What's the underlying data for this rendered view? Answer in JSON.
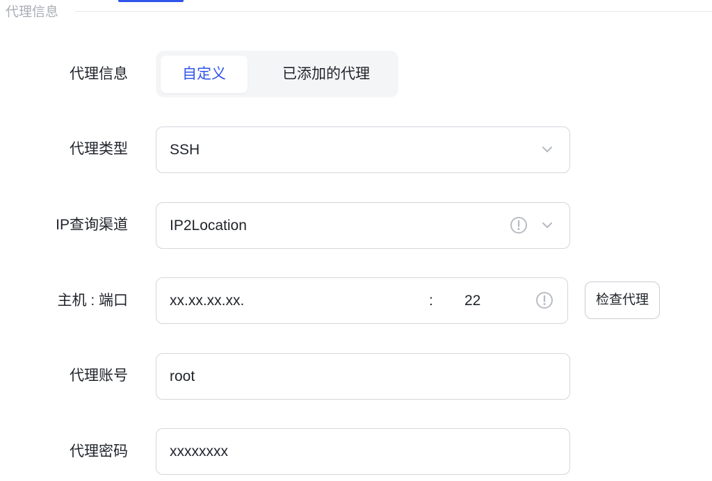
{
  "section": {
    "title": "代理信息"
  },
  "proxy_info": {
    "label": "代理信息",
    "tabs": [
      {
        "label": "自定义",
        "active": true
      },
      {
        "label": "已添加的代理",
        "active": false
      }
    ]
  },
  "proxy_type": {
    "label": "代理类型",
    "value": "SSH"
  },
  "ip_channel": {
    "label": "IP查询渠道",
    "value": "IP2Location"
  },
  "host_port": {
    "label": "主机 : 端口",
    "host": "xx.xx.xx.xx.",
    "separator": ":",
    "port": "22"
  },
  "check_button": {
    "label": "检查代理"
  },
  "proxy_account": {
    "label": "代理账号",
    "value": "root"
  },
  "proxy_password": {
    "label": "代理密码",
    "value": "xxxxxxxx"
  },
  "colors": {
    "accent": "#2f54eb",
    "border": "#d3d6db",
    "muted": "#a9adb4",
    "icon": "#b8bcc3"
  }
}
